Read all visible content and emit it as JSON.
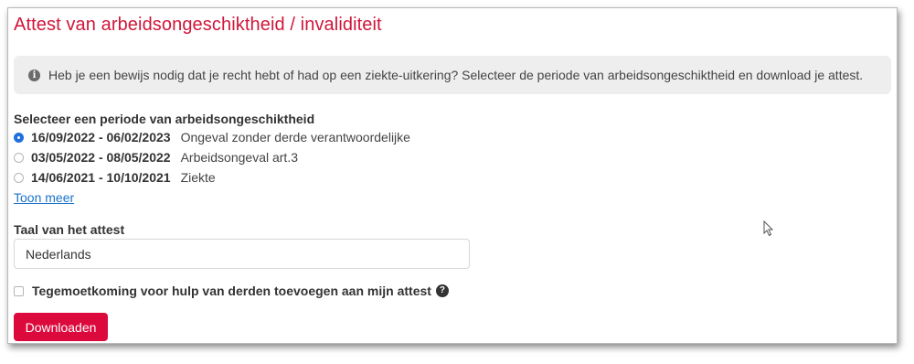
{
  "page": {
    "title": "Attest van arbeidsongeschiktheid / invaliditeit"
  },
  "info": {
    "icon": "info-circle-icon",
    "text": "Heb je een bewijs nodig dat je recht hebt of had op een ziekte-uitkering? Selecteer de periode van arbeidsongeschiktheid en download je attest."
  },
  "periods": {
    "label": "Selecteer een periode van arbeidsongeschiktheid",
    "items": [
      {
        "dates": "16/09/2022 - 06/02/2023",
        "type": "Ongeval zonder derde verantwoordelijke",
        "selected": true
      },
      {
        "dates": "03/05/2022 - 08/05/2022",
        "type": "Arbeidsongeval art.3",
        "selected": false
      },
      {
        "dates": "14/06/2021 - 10/10/2021",
        "type": "Ziekte",
        "selected": false
      }
    ],
    "show_more": "Toon meer"
  },
  "language": {
    "label": "Taal van het attest",
    "value": "Nederlands"
  },
  "third_party": {
    "label": "Tegemoetkoming voor hulp van derden toevoegen aan mijn attest",
    "checked": false,
    "help_icon": "question-circle-icon"
  },
  "actions": {
    "download": "Downloaden"
  },
  "colors": {
    "title": "#d0163a",
    "button": "#dc0a3c",
    "link": "#1a73c8",
    "radio_selected": "#1f6fde",
    "info_background": "#eeeeee"
  }
}
